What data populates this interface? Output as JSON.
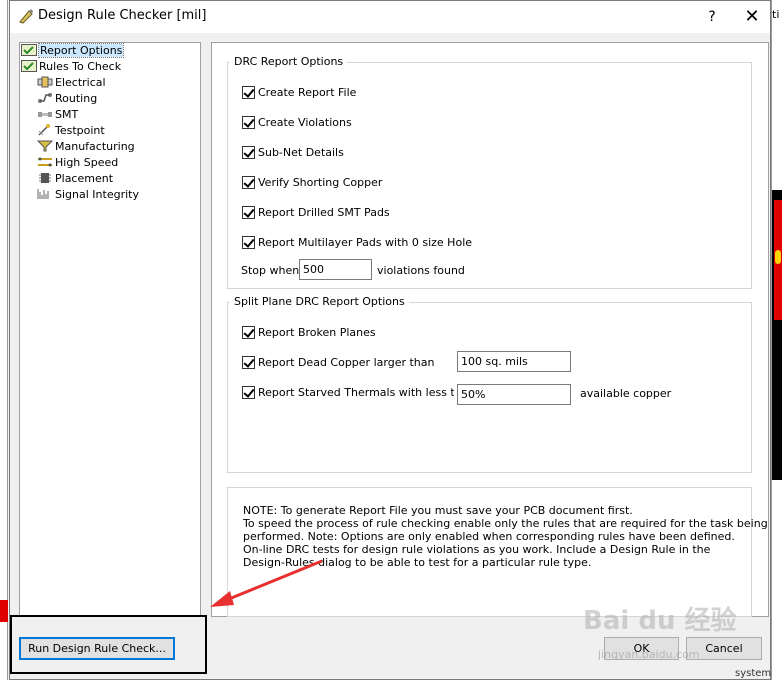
{
  "window": {
    "title": "Design Rule Checker [mil]",
    "help_label": "?",
    "close_label": "✕"
  },
  "tree": {
    "items": [
      {
        "label": "Report Options",
        "icon": "report-icon"
      },
      {
        "label": "Rules To Check",
        "icon": "rules-icon"
      },
      {
        "label": "Electrical",
        "icon": "electrical-icon"
      },
      {
        "label": "Routing",
        "icon": "routing-icon"
      },
      {
        "label": "SMT",
        "icon": "smt-icon"
      },
      {
        "label": "Testpoint",
        "icon": "testpoint-icon"
      },
      {
        "label": "Manufacturing",
        "icon": "manufacturing-icon"
      },
      {
        "label": "High Speed",
        "icon": "high-speed-icon"
      },
      {
        "label": "Placement",
        "icon": "placement-icon"
      },
      {
        "label": "Signal Integrity",
        "icon": "signal-integrity-icon"
      }
    ]
  },
  "drc_report": {
    "title": "DRC Report Options",
    "options": [
      {
        "label": "Create Report File",
        "checked": true
      },
      {
        "label": "Create Violations",
        "checked": true
      },
      {
        "label": "Sub-Net Details",
        "checked": true
      },
      {
        "label": "Verify Shorting Copper",
        "checked": true
      },
      {
        "label": "Report Drilled SMT Pads",
        "checked": true
      },
      {
        "label": "Report Multilayer Pads with 0 size Hole",
        "checked": true
      }
    ],
    "stop_when_label": "Stop when",
    "stop_when_value": "500",
    "violations_found_label": "violations found"
  },
  "split_plane": {
    "title": "Split Plane DRC Report Options",
    "broken_planes_label": "Report Broken Planes",
    "dead_copper_label": "Report Dead Copper larger than",
    "dead_copper_value": "100 sq. mils",
    "starved_thermals_label": "Report Starved Thermals with less thar",
    "starved_thermals_value": "50%",
    "available_copper_label": "available copper"
  },
  "note": {
    "lines": [
      "NOTE: To generate Report File you must save your PCB document first.",
      "To speed the process of rule checking enable only the rules that are required for the task being",
      "performed.  Note: Options are only enabled when corresponding rules have been defined.",
      "On-line DRC tests for design rule violations as you work. Include a Design Rule in the",
      "Design-Rules dialog to be able to test for a particular rule  type."
    ]
  },
  "buttons": {
    "run_label": "Run Design Rule Check...",
    "ok_label": "OK",
    "cancel_label": "Cancel"
  },
  "background": {
    "right_edge_text": "ti",
    "right_bottom_text": "system"
  },
  "watermark": {
    "text": "Bai du 经验",
    "subtext": "jingyan.baidu.com"
  },
  "colors": {
    "selection": "#cce8ff",
    "focus_border": "#0078d7",
    "arrow": "#e83030"
  }
}
